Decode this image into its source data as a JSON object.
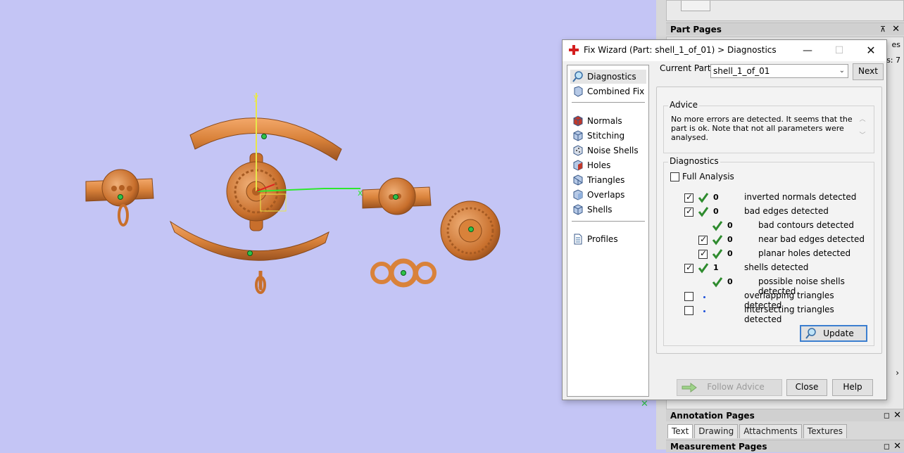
{
  "side_panel": {
    "part_pages": {
      "title": "Part Pages",
      "partial_text": "s: 7",
      "partial_tab": "es"
    },
    "annotation_pages": {
      "title": "Annotation Pages",
      "tabs": [
        "Text",
        "Drawing",
        "Attachments",
        "Textures"
      ]
    },
    "measurement_pages": {
      "title": "Measurement Pages"
    }
  },
  "viewport": {
    "axis_y": "y",
    "axis_x": "x"
  },
  "dialog": {
    "title": "Fix Wizard (Part: shell_1_of_01) > Diagnostics",
    "nav": {
      "top": [
        "Diagnostics",
        "Combined Fix"
      ],
      "tools": [
        "Normals",
        "Stitching",
        "Noise Shells",
        "Holes",
        "Triangles",
        "Overlaps",
        "Shells"
      ],
      "bottom": [
        "Profiles"
      ]
    },
    "current_part_label": "Current Part:",
    "current_part_value": "shell_1_of_01",
    "next_button": "Next",
    "advice": {
      "legend": "Advice",
      "text": "No more errors are detected. It seems that the part is ok. Note that not all parameters were analysed."
    },
    "diagnostics": {
      "legend": "Diagnostics",
      "full_analysis": "Full Analysis",
      "rows": [
        {
          "count": "0",
          "label": "inverted normals detected"
        },
        {
          "count": "0",
          "label": "bad edges detected"
        },
        {
          "count": "0",
          "label": "bad contours detected"
        },
        {
          "count": "0",
          "label": "near bad edges detected"
        },
        {
          "count": "0",
          "label": "planar holes detected"
        },
        {
          "count": "1",
          "label": "shells detected"
        },
        {
          "count": "0",
          "label": "possible noise shells detected"
        },
        {
          "count": "",
          "label": "overlapping triangles detected"
        },
        {
          "count": "",
          "label": "intersecting triangles detected"
        }
      ]
    },
    "update_button": "Update",
    "follow_advice_button": "Follow Advice",
    "close_button": "Close",
    "help_button": "Help"
  },
  "colors": {
    "viewport_bg": "#c4c5f5",
    "part_orange": "#d9823a",
    "check_green": "#2e8b2e",
    "axis_yellow": "#e8e84a",
    "axis_green": "#2ee82e"
  }
}
